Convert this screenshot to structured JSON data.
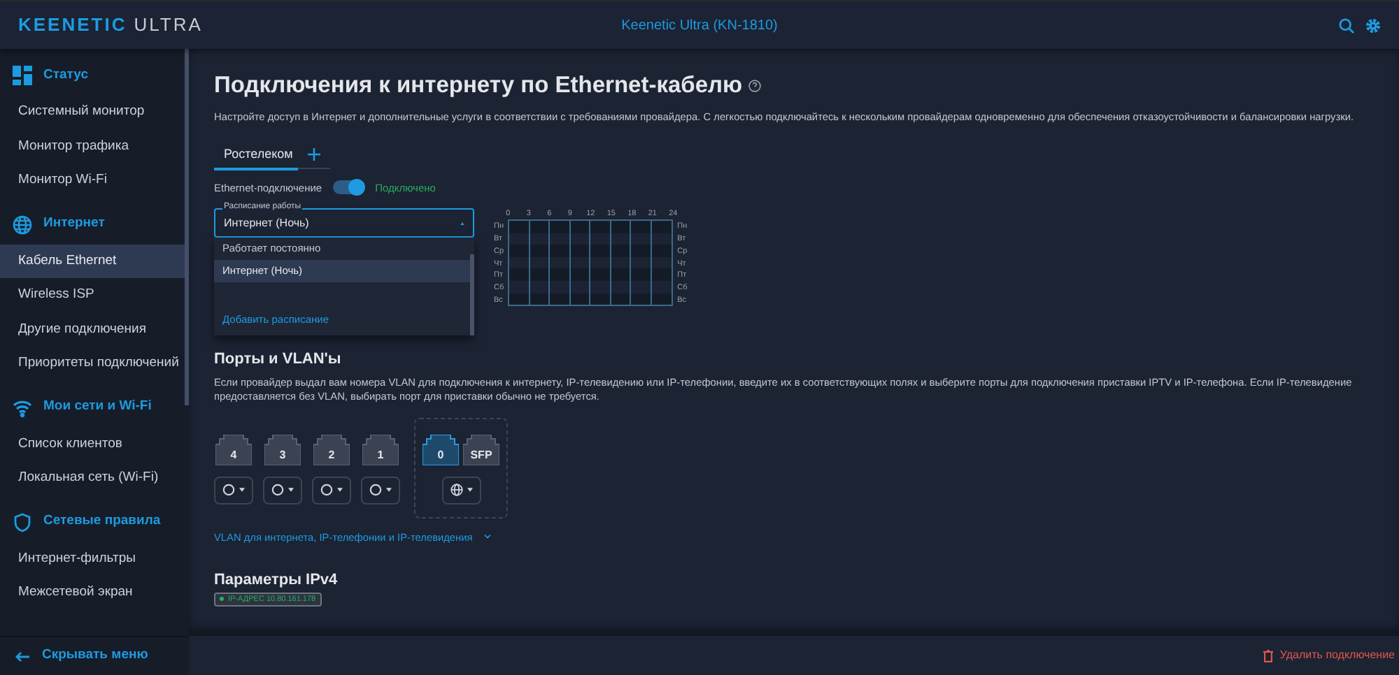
{
  "header": {
    "logo_bold": "KEENETIC",
    "logo_light": "ULTRA",
    "device": "Keenetic Ultra (KN-1810)"
  },
  "sidebar": {
    "groups": [
      {
        "kind": "status",
        "label": "Статус",
        "items": [
          {
            "label": "Системный монитор",
            "selected": false
          },
          {
            "label": "Монитор трафика",
            "selected": false
          },
          {
            "label": "Монитор Wi-Fi",
            "selected": false
          }
        ]
      },
      {
        "kind": "globe",
        "label": "Интернет",
        "items": [
          {
            "label": "Кабель Ethernet",
            "selected": true
          },
          {
            "label": "Wireless ISP",
            "selected": false
          },
          {
            "label": "Другие подключения",
            "selected": false
          },
          {
            "label": "Приоритеты подключений",
            "selected": false
          }
        ]
      },
      {
        "kind": "wifi",
        "label": "Мои сети и Wi-Fi",
        "items": [
          {
            "label": "Список клиентов",
            "selected": false
          },
          {
            "label": "Локальная сеть (Wi-Fi)",
            "selected": false
          }
        ]
      },
      {
        "kind": "shield",
        "label": "Сетевые правила",
        "items": [
          {
            "label": "Интернет-фильтры",
            "selected": false
          },
          {
            "label": "Межсетевой экран",
            "selected": false
          }
        ]
      }
    ],
    "footer": "Скрывать меню"
  },
  "page": {
    "title": "Подключения к интернету по Ethernet-кабелю",
    "description": "Настройте доступ в Интернет и дополнительные услуги в соответствии с требованиями провайдера. С легкостью подключайтесь к нескольким провайдерам одновременно для обеспечения отказоустойчивости и балансировки нагрузки."
  },
  "tabs": [
    {
      "label": "Ростелеком",
      "selected": true
    }
  ],
  "ethernet": {
    "label": "Ethernet-подключение",
    "on": true,
    "status": "Подключено"
  },
  "schedule": {
    "label": "Расписание работы",
    "value": "Интернет (Ночь)",
    "options": [
      {
        "label": "Работает постоянно",
        "selected": false
      },
      {
        "label": "Интернет (Ночь)",
        "selected": true
      }
    ],
    "add": "Добавить расписание",
    "hours": [
      "0",
      "3",
      "6",
      "9",
      "12",
      "15",
      "18",
      "21",
      "24"
    ],
    "days_left": [
      "Пн",
      "Вт",
      "Ср",
      "Чт",
      "Пт",
      "Сб",
      "Вс"
    ],
    "days_right": [
      "Пн",
      "Вт",
      "Ср",
      "Чт",
      "Пт",
      "Сб",
      "Вс"
    ]
  },
  "ports": {
    "title": "Порты и VLAN'ы",
    "description": "Если провайдер выдал вам номера VLAN для подключения к интернету, IP-телевидению или IP-телефонии, введите их в соответствующих полях и выберите порты для подключения приставки IPTV и IP-телефона. Если IP-телевидение предоставляется без VLAN, выбирать порт для приставки обычно не требуется.",
    "lan": [
      {
        "label": "4",
        "kind": "plain"
      },
      {
        "label": "3",
        "kind": "plain"
      },
      {
        "label": "2",
        "kind": "plain"
      },
      {
        "label": "1",
        "kind": "plain"
      }
    ],
    "wan": [
      {
        "label": "0",
        "selected": true
      },
      {
        "label": "SFP",
        "selected": false
      }
    ],
    "wan_select": {
      "kind": "internet"
    },
    "vlan_link": "VLAN для интернета, IP-телефонии и IP-телевидения"
  },
  "ipv4": {
    "title": "Параметры IPv4",
    "badge": "IP-АДРЕС 10.80.161.178"
  },
  "delete": "Удалить подключение"
}
